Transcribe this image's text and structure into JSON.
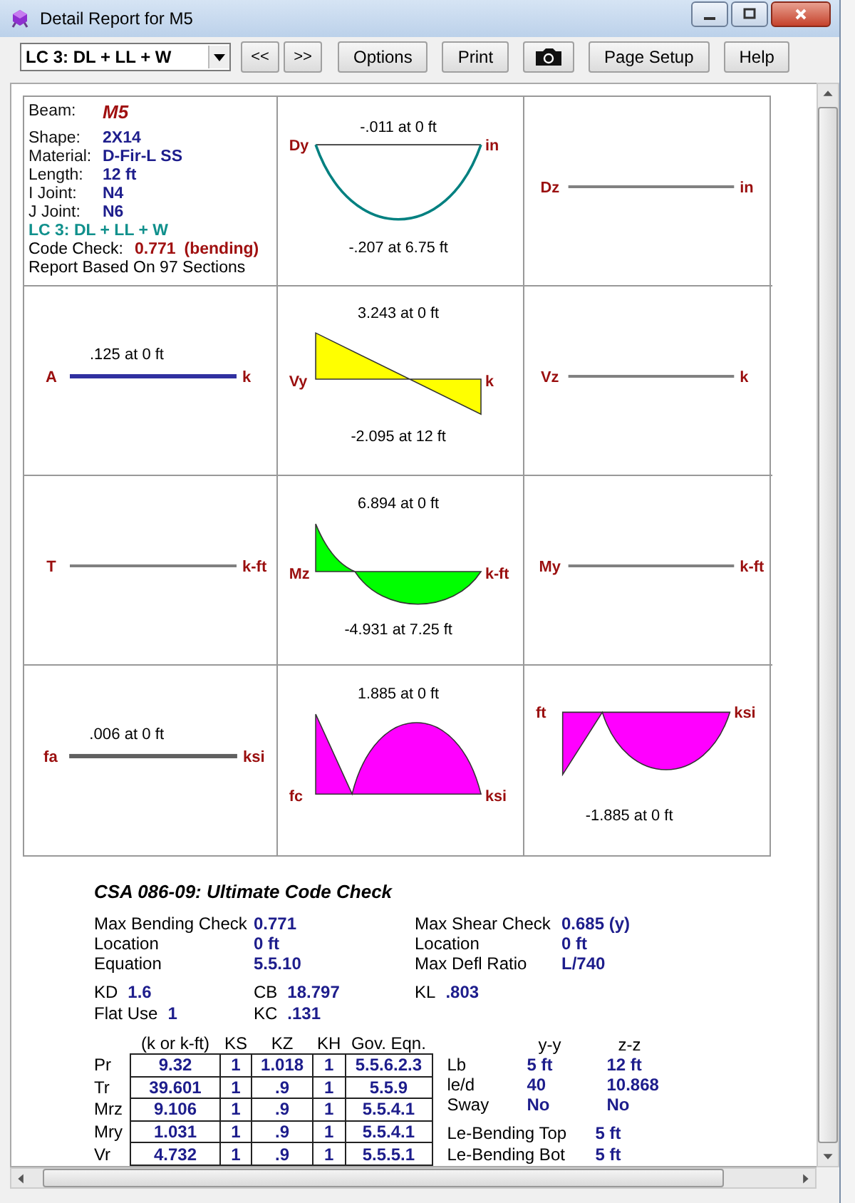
{
  "window": {
    "title": "Detail Report for M5"
  },
  "toolbar": {
    "load_combination": "LC 3: DL + LL + W",
    "buttons": [
      {
        "kind": "text",
        "label": "<<"
      },
      {
        "kind": "text",
        "label": ">>"
      },
      {
        "kind": "text",
        "label": "Options"
      },
      {
        "kind": "text",
        "label": "Print"
      },
      {
        "kind": "camera"
      },
      {
        "kind": "text",
        "label": "Page Setup"
      },
      {
        "kind": "text",
        "label": "Help"
      }
    ]
  },
  "summary": {
    "beam_label": "Beam:",
    "beam": "M5",
    "fields": [
      {
        "label": "Shape:",
        "value": "2X14"
      },
      {
        "label": "Material:",
        "value": "D-Fir-L SS"
      },
      {
        "label": "Length:",
        "value": "12 ft"
      },
      {
        "label": "I Joint:",
        "value": "N4"
      },
      {
        "label": "J Joint:",
        "value": "N6"
      }
    ],
    "load_combination": "LC 3: DL + LL + W",
    "code_check_label": "Code Check:",
    "code_check": "0.771",
    "code_check_note": "(bending)",
    "sections_note": "Report Based On 97 Sections"
  },
  "plots": [
    {
      "kind": "deflection",
      "left_label": "Dy",
      "right_label": "in",
      "top_value": "-.011 at 0 ft",
      "bottom_value": "-.207 at 6.75 ft",
      "color": "#008080"
    },
    {
      "kind": "flat",
      "left_label": "Dz",
      "right_label": "in",
      "color": "#808080"
    },
    {
      "kind": "flat",
      "left_label": "A",
      "right_label": "k",
      "top_value": ".125 at 0 ft",
      "color": "#3030a0"
    },
    {
      "kind": "shear",
      "left_label": "Vy",
      "right_label": "k",
      "top_value": "3.243 at 0 ft",
      "bottom_value": "-2.095 at 12 ft",
      "color": "#ffff00"
    },
    {
      "kind": "flat",
      "left_label": "Vz",
      "right_label": "k",
      "color": "#808080"
    },
    {
      "kind": "flat",
      "left_label": "T",
      "right_label": "k-ft",
      "color": "#808080"
    },
    {
      "kind": "moment",
      "left_label": "Mz",
      "right_label": "k-ft",
      "top_value": "6.894 at 0 ft",
      "bottom_value": "-4.931 at 7.25 ft",
      "color": "#00ff00"
    },
    {
      "kind": "flat",
      "left_label": "My",
      "right_label": "k-ft",
      "color": "#808080"
    },
    {
      "kind": "flat",
      "left_label": "fa",
      "right_label": "ksi",
      "top_value": ".006 at 0 ft",
      "color": "#606060"
    },
    {
      "kind": "compression",
      "left_label": "fc",
      "right_label": "ksi",
      "top_value": "1.885 at 0 ft",
      "color": "#ff00ff"
    },
    {
      "kind": "tension",
      "left_label": "ft",
      "right_label": "ksi",
      "bottom_value": "-1.885 at 0 ft",
      "color": "#ff00ff"
    }
  ],
  "code_check": {
    "title": "CSA 086-09: Ultimate Code Check",
    "left": [
      {
        "label": "Max Bending Check",
        "value": "0.771"
      },
      {
        "label": "Location",
        "value": "0 ft"
      },
      {
        "label": "Equation",
        "value": "5.5.10"
      }
    ],
    "right": [
      {
        "label": "Max Shear Check",
        "value": "0.685 (y)"
      },
      {
        "label": "Location",
        "value": "0 ft"
      },
      {
        "label": "Max Defl Ratio",
        "value": "L/740"
      }
    ],
    "factors": [
      [
        {
          "label": "KD",
          "value": "1.6"
        },
        {
          "label": "CB",
          "value": "18.797"
        },
        {
          "label": "KL",
          "value": ".803"
        }
      ],
      [
        {
          "label": "Flat Use",
          "value": "1"
        },
        {
          "label": "KC",
          "value": ".131"
        }
      ]
    ],
    "table": {
      "columns": [
        "(k or k-ft)",
        "KS",
        "KZ",
        "KH",
        "Gov. Eqn."
      ],
      "rows": [
        {
          "label": "Pr",
          "cells": [
            "9.32",
            "1",
            "1.018",
            "1",
            "5.5.6.2.3"
          ]
        },
        {
          "label": "Tr",
          "cells": [
            "39.601",
            "1",
            ".9",
            "1",
            "5.5.9"
          ]
        },
        {
          "label": "Mrz",
          "cells": [
            "9.106",
            "1",
            ".9",
            "1",
            "5.5.4.1"
          ]
        },
        {
          "label": "Mry",
          "cells": [
            "1.031",
            "1",
            ".9",
            "1",
            "5.5.4.1"
          ]
        },
        {
          "label": "Vr",
          "cells": [
            "4.732",
            "1",
            ".9",
            "1",
            "5.5.5.1"
          ]
        }
      ]
    },
    "lengths": {
      "columns": [
        "y-y",
        "z-z"
      ],
      "rows": [
        {
          "label": "Lb",
          "values": [
            "5 ft",
            "12 ft"
          ]
        },
        {
          "label": "le/d",
          "values": [
            "40",
            "10.868"
          ]
        },
        {
          "label": "Sway",
          "values": [
            "No",
            "No"
          ]
        }
      ]
    },
    "bending_lengths": [
      {
        "label": "Le-Bending Top",
        "value": "5 ft"
      },
      {
        "label": "Le-Bending Bot",
        "value": "5 ft"
      }
    ]
  }
}
